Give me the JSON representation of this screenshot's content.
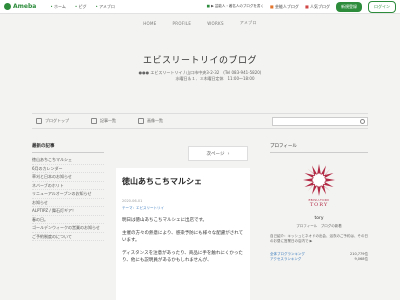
{
  "topbar": {
    "logo": "Ameba",
    "nav": [
      "ホーム",
      "ピグ",
      "アメブロ"
    ],
    "right_links": [
      "芸能人ブログ",
      "人気ブログ"
    ],
    "right_links_prefix": "▶ 芸能人・著名人のブログを書く",
    "register": "新規登録",
    "login": "ログイン"
  },
  "blognav": [
    "HOME",
    "PROFILE",
    "WORKS",
    "アメブロ"
  ],
  "header": {
    "title": "エビスリートリイのブログ",
    "address_line1": "●●● エビスリートリイ / 山口市中央3-2-32　(Tel 083-941-5820)",
    "address_line2": "水曜日＆１．３木曜日定休　11:00～18:00"
  },
  "toolbar": {
    "items": [
      "ブログトップ",
      "記事一覧",
      "画像一覧"
    ]
  },
  "left": {
    "heading": "最新の記事",
    "items": [
      "徳山あちこちマルシェ",
      "6月のカレンダー",
      "草刈と日本のお知らせ",
      "ネバーブのホリト",
      "リニューアルオープンのお知らせ",
      "お知らせ",
      "ALPTIPZ / 舞石灯ギア！",
      "春の日。",
      "ゴールデンウィークの営業のお知らせ",
      "ご予約制度のについて"
    ]
  },
  "pager": {
    "label": "次ページ",
    "chevron": "›"
  },
  "article": {
    "title": "徳山あちこちマルシェ",
    "date": "2020-06-01",
    "theme": "テーマ：エビスリートリイ",
    "paragraphs": [
      "明日は徳山あちこちマルシェに出店です。",
      "主催の方々の熱意により、感染予防にも様々な配慮がされています。",
      "ディスタンスを注意があったり、商品に手を触れにくかったり、他にも説明員があるかもしれませんが、"
    ]
  },
  "right": {
    "heading": "プロフィール",
    "emblem_text": "TORY",
    "emblem_sub": "EBISU-TORII",
    "name": "tory",
    "links": "プロフィール　ブログの新着",
    "profile_text": "自己紹介：キッシュとネオドの出会、浴衣のご予約は、その日のお昼に営業日の店内で ▶",
    "ranking": [
      {
        "label": "全体ブログランキング",
        "value": "210,779位"
      },
      {
        "label": "アクセスランキング",
        "value": "9,068位"
      }
    ]
  },
  "colors": {
    "ameba_green": "#2d8c3c",
    "emblem_red": "#b22a45",
    "link_blue": "#3a7bbf"
  }
}
